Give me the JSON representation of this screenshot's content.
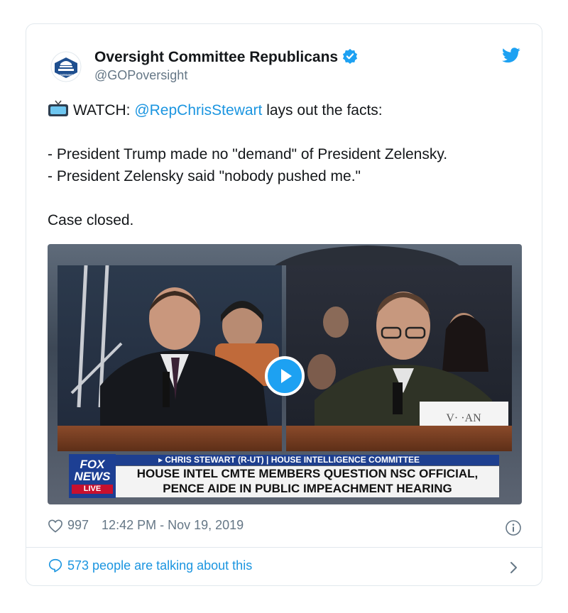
{
  "account": {
    "name": "Oversight Committee Republicans",
    "handle": "@GOPoversight",
    "avatar_text": "OVERSIGHT"
  },
  "tweet": {
    "line1_prefix": "WATCH: ",
    "line1_mention": "@RepChrisStewart",
    "line1_suffix": " lays out the facts:",
    "bullet1": "- President Trump made no \"demand\" of President Zelensky.",
    "bullet2": "- President Zelensky said \"nobody pushed me.\"",
    "closing": "Case closed."
  },
  "video": {
    "chyron_top": "▸ CHRIS STEWART (R-UT) | HOUSE INTELLIGENCE COMMITTEE",
    "headline_line1": "HOUSE INTEL CMTE MEMBERS QUESTION NSC OFFICIAL,",
    "headline_line2": "PENCE AIDE IN PUBLIC IMPEACHMENT HEARING",
    "logo_line1": "FOX",
    "logo_line2": "NEWS",
    "logo_live": "LIVE",
    "nameplate": "V·   ·AN"
  },
  "footer": {
    "likes": "997",
    "timestamp": "12:42 PM - Nov 19, 2019",
    "talking": "573 people are talking about this"
  },
  "colors": {
    "accent": "#1da1f2",
    "link": "#1b95e0",
    "muted": "#657786"
  },
  "icons": [
    "capitol-avatar-icon",
    "verified-badge-icon",
    "twitter-bird-icon",
    "tv-emoji-icon",
    "play-icon",
    "heart-icon",
    "info-icon",
    "speech-bubble-icon",
    "chevron-right-icon"
  ]
}
